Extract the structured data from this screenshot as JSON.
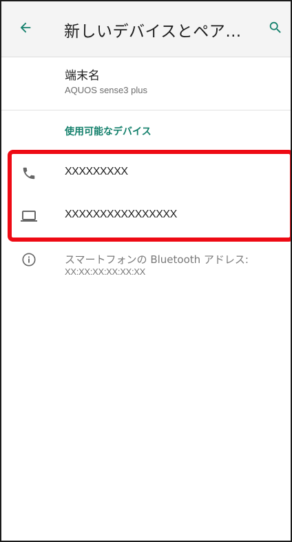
{
  "appbar": {
    "title": "新しいデバイスとペア…",
    "back_icon": "arrow-back-icon",
    "search_icon": "search-icon",
    "accent_color": "#14806c"
  },
  "device_name": {
    "label": "端末名",
    "value": "AQUOS sense3 plus"
  },
  "available_section": {
    "header": "使用可能なデバイス",
    "devices": [
      {
        "icon": "phone-icon",
        "name": "XXXXXXXXX"
      },
      {
        "icon": "laptop-icon",
        "name": "XXXXXXXXXXXXXXXX"
      }
    ]
  },
  "highlight_color": "#ee0a14",
  "info": {
    "icon": "info-icon",
    "line1": "スマートフォンの Bluetooth アドレス:",
    "line2": "XX:XX:XX:XX:XX:XX"
  }
}
